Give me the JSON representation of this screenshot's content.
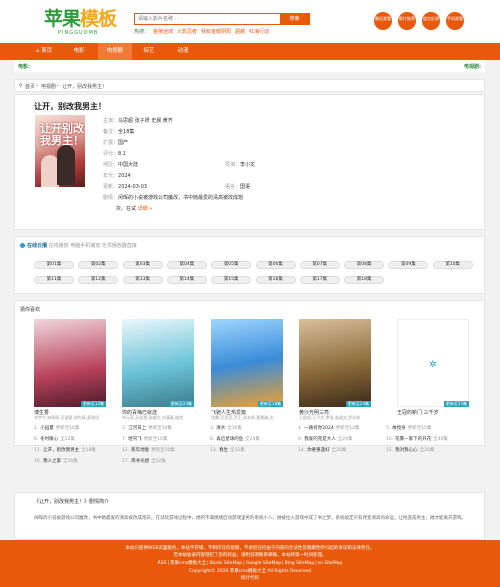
{
  "header": {
    "logo_main": "苹果",
    "logo_accent": "模板",
    "logo_sub": "PINGGUOMB",
    "search_placeholder": "请输入影片名称 · · ·",
    "search_button": "搜索",
    "hot_label": "热搜：",
    "hot_keywords": [
      "金陵迷城",
      "火影忍者",
      "我有金眼阴阳",
      "超越",
      "红海行动"
    ],
    "badges": [
      "最近观看",
      "影片推荐",
      "留言反馈",
      "手机观看"
    ]
  },
  "nav": {
    "items": [
      "首页",
      "电影",
      "电视剧",
      "综艺",
      "动漫"
    ],
    "active": 2
  },
  "subbar": {
    "left": "电影:",
    "right": "电视剧:"
  },
  "breadcrumb": {
    "home": "首页",
    "sep1": "›",
    "level1": "电视剧",
    "sep2": "›",
    "current": "让开，别改我男主！"
  },
  "detail": {
    "title": "让开，别改我男主！",
    "poster_text": "让开别改我男主！",
    "fields": [
      {
        "label": "主演：",
        "value": "马思超 张子妍 史晨 黄齐"
      },
      {
        "label": "备注：",
        "value": "全18集"
      },
      {
        "label": "扩展：",
        "value": "国产"
      },
      {
        "label": "评分：",
        "value": "8.1"
      },
      {
        "label": "地区：",
        "value": "中国大陆"
      },
      {
        "label": "年代：",
        "value": "2024"
      },
      {
        "label": "更新：",
        "value": "2024-03-03"
      }
    ],
    "director_label": "导演：",
    "director": "李小龙",
    "lang_label": "语言：",
    "lang": "国语",
    "intro_label": "剧情：",
    "intro_line1": "闲晖的小说被游戏公司魔改，书中她最爱的清高被改成炮",
    "intro_line2": "灰。在试",
    "more": "详细 »"
  },
  "play": {
    "source_name": "在线云播",
    "tip": "在线播放 电脑手机播放·无须播放器直接",
    "episodes": [
      "第01集",
      "第02集",
      "第03集",
      "第04集",
      "第05集",
      "第06集",
      "第07集",
      "第08集",
      "第09集",
      "第10集",
      "第11集",
      "第12集",
      "第13集",
      "第14集",
      "第15集",
      "第16集",
      "第17集",
      "第18集"
    ]
  },
  "rec": {
    "heading": "猜你喜欢",
    "cards": [
      {
        "name": "博生香",
        "desc": "刘宇宁,林周晖,可爱客,胡先杨,蔡恩坦",
        "tag": "更新至12集",
        "color": "#b7425a"
      },
      {
        "name": "你的青梅已就选",
        "desc": "刘元家,吕丝悦,张婉文,刘满春,姚良",
        "tag": "更新至23集",
        "color": "#6cc3d8"
      },
      {
        "name": "飞驰人生热爱篇",
        "desc": "沈腾,范丞丞,尹正,张本煜,黄景瑜,沈",
        "tag": "更新至18集",
        "color": "#3a8cd8"
      },
      {
        "name": "黄沙光明三亮",
        "desc": "王俊凯,王子文,李强,张颂文,罗志祥",
        "tag": "更新至24集",
        "color": "#8c6a3a"
      },
      {
        "name": "王冠的新门 三千岁",
        "desc": "",
        "tag": "更新至15集",
        "color": "#ffffff"
      }
    ],
    "lists": [
      [
        {
          "n": "1.",
          "t": "小园夏",
          "s": "更新至16集"
        },
        {
          "n": "2.",
          "t": "江河日上",
          "s": "更新至30集"
        },
        {
          "n": "3.",
          "t": "清水",
          "s": "全16集"
        },
        {
          "n": "4.",
          "t": "一路有你2024",
          "s": "更新至14集"
        },
        {
          "n": "5.",
          "t": "故授身",
          "s": "更新至15集"
        }
      ],
      [
        {
          "n": "6.",
          "t": "冬时暖心",
          "s": "全12集"
        },
        {
          "n": "7.",
          "t": "哈刊飞",
          "s": "更新至16集"
        },
        {
          "n": "8.",
          "t": "再启星球的鱼",
          "s": "全20集"
        },
        {
          "n": "9.",
          "t": "我爱的完是大人",
          "s": "全24集"
        },
        {
          "n": "10.",
          "t": "花雾一家下的开花",
          "s": "全40集"
        }
      ],
      [
        {
          "n": "11.",
          "t": "让开，别改我男主",
          "s": "全18集"
        },
        {
          "n": "12.",
          "t": "惹年地誓",
          "s": "更新至10集"
        },
        {
          "n": "13.",
          "t": "春生",
          "s": "全31集"
        },
        {
          "n": "14.",
          "t": "你要重逢好",
          "s": "全20集"
        },
        {
          "n": "15.",
          "t": "我对我心心",
          "s": "全20集"
        }
      ],
      [
        {
          "n": "16.",
          "t": "像人之家",
          "s": "全30集"
        },
        {
          "n": "17.",
          "t": "南寻光想",
          "s": "全32集"
        }
      ]
    ]
  },
  "plot": {
    "heading": "《让开，别改我男主！》剧情简介",
    "text": "闲晖的小说被游戏公司魔改，书中她最爱的清高被改成炮灰。在试玩游戏过程中，她的不满情绪启动游戏里男的系统小八，她被拉入游戏中成了书之梦。系统规定只有改变清高的命运，让他变成男主，她才能离开游戏。"
  },
  "footer": {
    "line1": "本站只提供WEB页面服务，本站不存储、不制作任何视频，不承担任何由于内容的合法性及健康性所引起的争议和法律责任。",
    "line2": "若本站收录内容侵犯了您的权益，请附说明联系邮箱，本站将第一时间处理。",
    "links": [
      "RSS",
      "苹果cms模板大全",
      "Baidu SiteMap",
      "Google SiteMap",
      "Bing SiteMap",
      "so SiteMap"
    ],
    "copyright": "Copyright© 2020 苹果cms模板大全 All Rights Reserved",
    "stats": "统计代码"
  },
  "colors": {
    "brand": "#e8590c",
    "green": "#2e9a3a",
    "tag": "#2aa3b8"
  }
}
